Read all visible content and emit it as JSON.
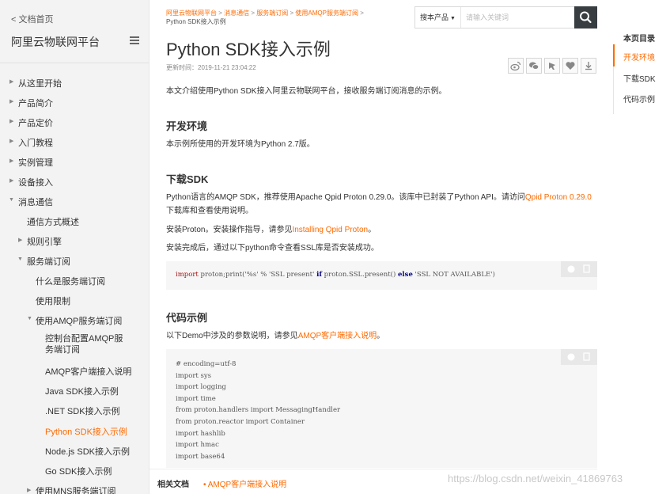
{
  "sidebar": {
    "back_label": "< 文档首页",
    "title": "阿里云物联网平台",
    "items": [
      {
        "label": "从这里开始"
      },
      {
        "label": "产品简介"
      },
      {
        "label": "产品定价"
      },
      {
        "label": "入门教程"
      },
      {
        "label": "实例管理"
      },
      {
        "label": "设备接入"
      },
      {
        "label": "消息通信"
      },
      {
        "label": "通信方式概述"
      },
      {
        "label": "规则引擎"
      },
      {
        "label": "服务端订阅"
      },
      {
        "label": "什么是服务端订阅"
      },
      {
        "label": "使用限制"
      },
      {
        "label": "使用AMQP服务端订阅"
      },
      {
        "label": "控制台配置AMQP服务端订阅"
      },
      {
        "label": "AMQP客户端接入说明"
      },
      {
        "label": "Java SDK接入示例"
      },
      {
        "label": ".NET SDK接入示例"
      },
      {
        "label": "Python SDK接入示例"
      },
      {
        "label": "Node.js SDK接入示例"
      },
      {
        "label": "Go SDK接入示例"
      },
      {
        "label": "使用MNS服务端订阅"
      }
    ]
  },
  "breadcrumb": {
    "items": [
      "阿里云物联网平台",
      "消息通信",
      "服务端订阅",
      "使用AMQP服务端订阅"
    ],
    "current": "Python SDK接入示例",
    "separator": ">"
  },
  "search": {
    "scope": "搜本产品",
    "placeholder": "请输入关键词"
  },
  "article": {
    "title": "Python SDK接入示例",
    "update_time": "更新时间：2019-11-21 23:04:22",
    "intro": "本文介绍使用Python SDK接入阿里云物联网平台，接收服务端订阅消息的示例。",
    "sections": [
      {
        "heading": "开发环境",
        "text": "本示例所使用的开发环境为Python 2.7版。"
      },
      {
        "heading": "下载SDK",
        "p1_before": "Python语言的AMQP SDK，推荐使用Apache Qpid Proton 0.29.0。该库中已封装了Python API。请访问",
        "p1_link": "Qpid Proton 0.29.0",
        "p1_after": "下载库和查看使用说明。",
        "p2_before": "安装Proton。安装操作指导，请参见",
        "p2_link": "Installing Qpid Proton",
        "p2_after": "。",
        "p3": "安装完成后，通过以下python命令查看SSL库是否安装成功。",
        "code": {
          "t1": "import",
          "t2": " proton;print('%s' % 'SSL present' ",
          "t3": "if",
          "t4": " proton.SSL.present() ",
          "t5": "else",
          "t6": " 'SSL NOT AVAILABLE')"
        }
      },
      {
        "heading": "代码示例",
        "text_before": "以下Demo中涉及的参数说明，请参见",
        "text_link": "AMQP客户端接入说明",
        "text_after": "。",
        "code_lines": [
          "# encoding=utf-8",
          "import sys",
          "import logging",
          "import time",
          "from proton.handlers import MessagingHandler",
          "from proton.reactor import Container",
          "import hashlib",
          "import hmac",
          "import base64"
        ]
      }
    ]
  },
  "toc": {
    "title": "本页目录",
    "items": [
      "开发环境",
      "下载SDK",
      "代码示例"
    ]
  },
  "related": {
    "label": "相关文档",
    "link": "AMQP客户端接入说明"
  },
  "watermark": "https://blog.csdn.net/weixin_41869763",
  "colors": {
    "accent": "#ff6a00",
    "sidebar_bg": "#f3f3f3",
    "code_bg": "#f6f6f6",
    "search_button": "#373d41"
  }
}
